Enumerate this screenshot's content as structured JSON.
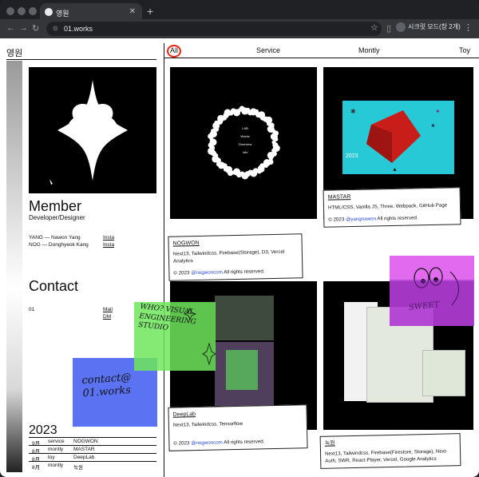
{
  "browser": {
    "tab_title": "영원",
    "url": "01.works",
    "profile_label": "시크릿 모드(창 2개)"
  },
  "left": {
    "site_title": "영원",
    "member_heading": "Member",
    "member_sub": "Developer/Designer",
    "members": [
      {
        "text": "YANG — Nawon Yang",
        "link": "Insta"
      },
      {
        "text": "NOG — Donghyeok Kang",
        "link": "Insta"
      }
    ],
    "contact_heading": "Contact",
    "contact_num": "01",
    "contact_links": [
      "Mail",
      "DM"
    ],
    "blue_note": "contact@ 01.works",
    "green_note": "WHO? VISUAL ENGINEERING STUDIO",
    "year": "2023",
    "log": [
      {
        "month": "9月",
        "type": "service",
        "name": "NOGWON"
      },
      {
        "month": "8月",
        "type": "montly",
        "name": "MASTAR"
      },
      {
        "month": "8月",
        "type": "toy",
        "name": "DeepLab"
      },
      {
        "month": "8月",
        "type": "montly",
        "name": "녹원"
      }
    ]
  },
  "filters": [
    "All",
    "Service",
    "Montly",
    "Toy"
  ],
  "cards": [
    {
      "name": "NOGWON",
      "stack": "Next13, Tailwindcss, Firebase(Storage), D3, Vercel Analytics",
      "copy_prefix": "© 2023",
      "handle": "@nogwoncom",
      "copy_suffix": "All rights reserved.",
      "menu": [
        "LAB",
        "Works",
        "Overview",
        "Info"
      ]
    },
    {
      "name": "MASTAR",
      "stack": "HTML/CSS, Vanilla JS, Three, Webpack, GitHub Page",
      "copy_prefix": "© 2023",
      "handle": "@yangnawon",
      "copy_suffix": "All rights reserved.",
      "screen_year": "2023"
    },
    {
      "name": "DeepLab",
      "stack": "Next13, Tailwindcss, Tensorflow",
      "copy_prefix": "© 2023",
      "handle": "@nogwoncom",
      "copy_suffix": "All rights reserved."
    },
    {
      "name": "녹원",
      "stack": "Next13, Tailwindcss, Firebase(Firestore, Storage), Next-Auth, SWR, React-Player, Vercel, Google Analytics"
    }
  ],
  "magenta_note": "SWEET",
  "colors": {
    "accent_red": "#e21",
    "link_blue": "#2749d6",
    "blue_note": "#5b73f2",
    "green_note": "#6ee65a",
    "magenta_note": "#dc50eb"
  }
}
